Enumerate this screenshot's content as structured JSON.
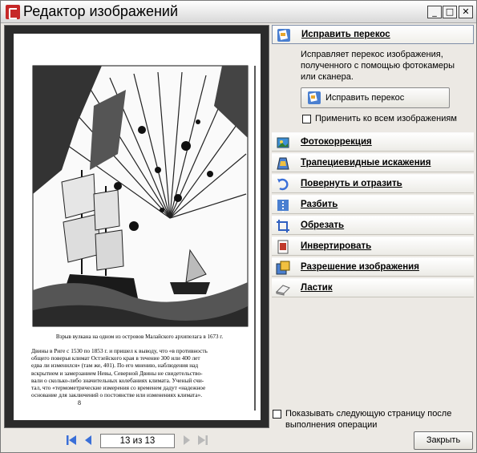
{
  "window": {
    "title": "Редактор изображений"
  },
  "preview": {
    "caption": "Взрыв вулкана на одном из островов Малайского архипелага в 1673 г.",
    "body_lines": [
      "Двины в Риге с 1530 по 1853 г. и пришел к выводу, что «в противность",
      "общего поверья климат Остзейского края в течение 300 или 400 лет",
      "едва ли изменился» (там же, 401). По его мнению, наблюдения над",
      "вскрытием и замерзанием Невы, Северной Двины не свидетельство-",
      "вали о сколько-либо значительных колебаниях климата. Ученый счи-",
      "тал, что «термометрические измерения со временем дадут «надежное",
      "основание для заключений о постоянстве или изменениях климата»."
    ],
    "page_number": "8"
  },
  "panel": {
    "active_section": {
      "label": "Исправить перекос",
      "icon": "deskew-icon",
      "description": "Исправляет перекос изображения, полученного с помощью фотокамеры или сканера.",
      "button_label": "Исправить перекос",
      "apply_all_label": "Применить ко всем изображениям"
    },
    "sections": [
      {
        "label": "Фотокоррекция",
        "icon": "photo-correction-icon"
      },
      {
        "label": "Трапециевидные искажения",
        "icon": "trapezoid-distortion-icon"
      },
      {
        "label": "Повернуть и отразить",
        "icon": "rotate-flip-icon"
      },
      {
        "label": "Разбить",
        "icon": "split-icon"
      },
      {
        "label": "Обрезать",
        "icon": "crop-icon"
      },
      {
        "label": "Инвертировать",
        "icon": "invert-icon"
      },
      {
        "label": "Разрешение изображения",
        "icon": "resolution-icon"
      },
      {
        "label": "Ластик",
        "icon": "eraser-icon"
      }
    ],
    "show_next_label_line1": "Показывать следующую страницу после",
    "show_next_label_line2": "выполнения операции"
  },
  "navigation": {
    "page_indicator": "13 из 13"
  },
  "footer": {
    "close_label": "Закрыть"
  },
  "colors": {
    "nav_blue": "#3a6fd8",
    "nav_disabled": "#b9b9b9",
    "preview_bg": "#2b2b2b"
  }
}
